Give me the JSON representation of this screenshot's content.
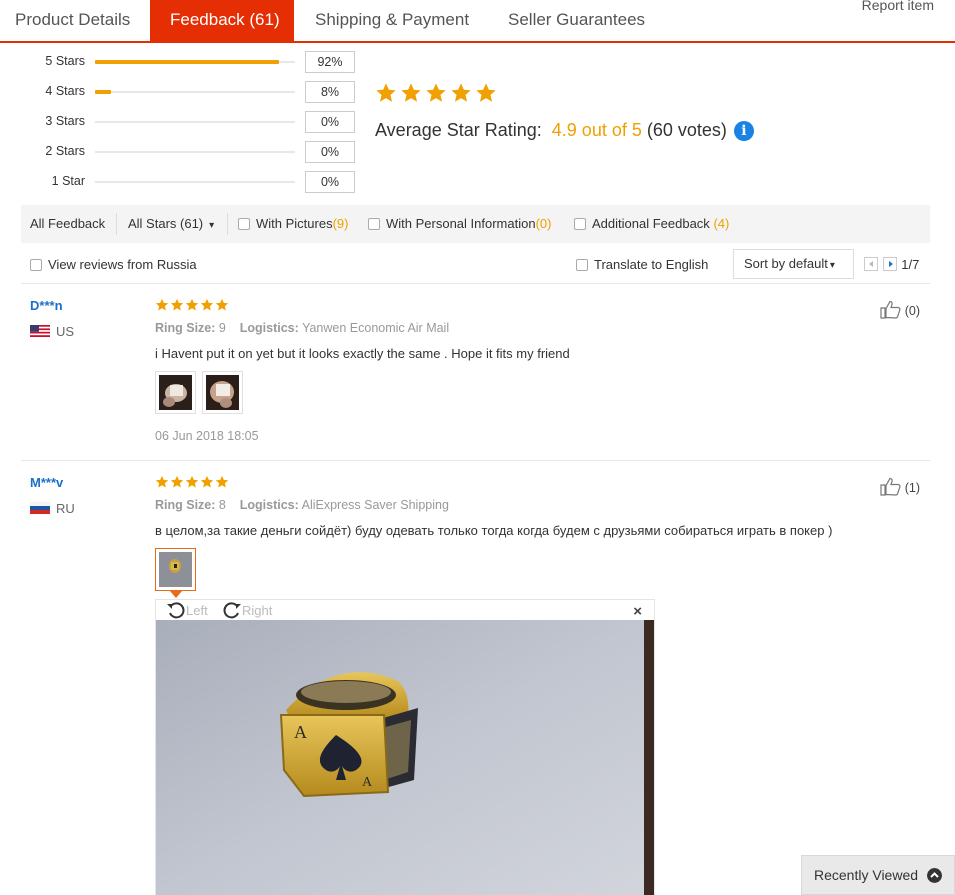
{
  "tabs": [
    {
      "label": "Product Details"
    },
    {
      "label": "Feedback (61)"
    },
    {
      "label": "Shipping & Payment"
    },
    {
      "label": "Seller Guarantees"
    }
  ],
  "report_label": "Report item",
  "distribution": [
    {
      "label": "5 Stars",
      "pct_text": "92%",
      "fraction": 0.92
    },
    {
      "label": "4 Stars",
      "pct_text": "8%",
      "fraction": 0.08
    },
    {
      "label": "3 Stars",
      "pct_text": "0%",
      "fraction": 0
    },
    {
      "label": "2 Stars",
      "pct_text": "0%",
      "fraction": 0
    },
    {
      "label": "1 Star",
      "pct_text": "0%",
      "fraction": 0
    }
  ],
  "rating": {
    "label": "Average Star Rating:",
    "score": "4.9 out of 5",
    "votes": "(60 votes)",
    "info_icon": "info-icon"
  },
  "filters": {
    "all_feedback": "All Feedback",
    "all_stars": "All Stars (61)",
    "with_pictures": {
      "label": "With Pictures",
      "count": "(9)"
    },
    "with_personal": {
      "label": "With Personal Information",
      "count": "(0)"
    },
    "additional": {
      "label": "Additional Feedback",
      "count": "(4)"
    },
    "view_russia": "View reviews from Russia",
    "translate": "Translate to English",
    "sort": "Sort by default",
    "page": "1/7"
  },
  "reviews": [
    {
      "name": "D***n",
      "country": "US",
      "attr1_label": "Ring Size:",
      "attr1_value": "9",
      "attr2_label": "Logistics:",
      "attr2_value": "Yanwen Economic Air Mail",
      "text": "i Havent put it on yet but it looks exactly the same . Hope it fits my friend",
      "date": "06 Jun 2018 18:05",
      "helpful": "(0)"
    },
    {
      "name": "M***v",
      "country": "RU",
      "attr1_label": "Ring Size:",
      "attr1_value": "8",
      "attr2_label": "Logistics:",
      "attr2_value": "AliExpress Saver Shipping",
      "text": "в целом,за такие деньги сойдёт) буду одевать только тогда когда будем с друзьями собираться играть в покер )",
      "helpful": "(1)"
    }
  ],
  "viewer": {
    "rotate_left": "Left",
    "rotate_right": "Right",
    "close": "×"
  },
  "recently_viewed": "Recently Viewed",
  "colors": {
    "accent": "#e62e04",
    "star": "#f0a000",
    "link": "#1a6fc9"
  }
}
